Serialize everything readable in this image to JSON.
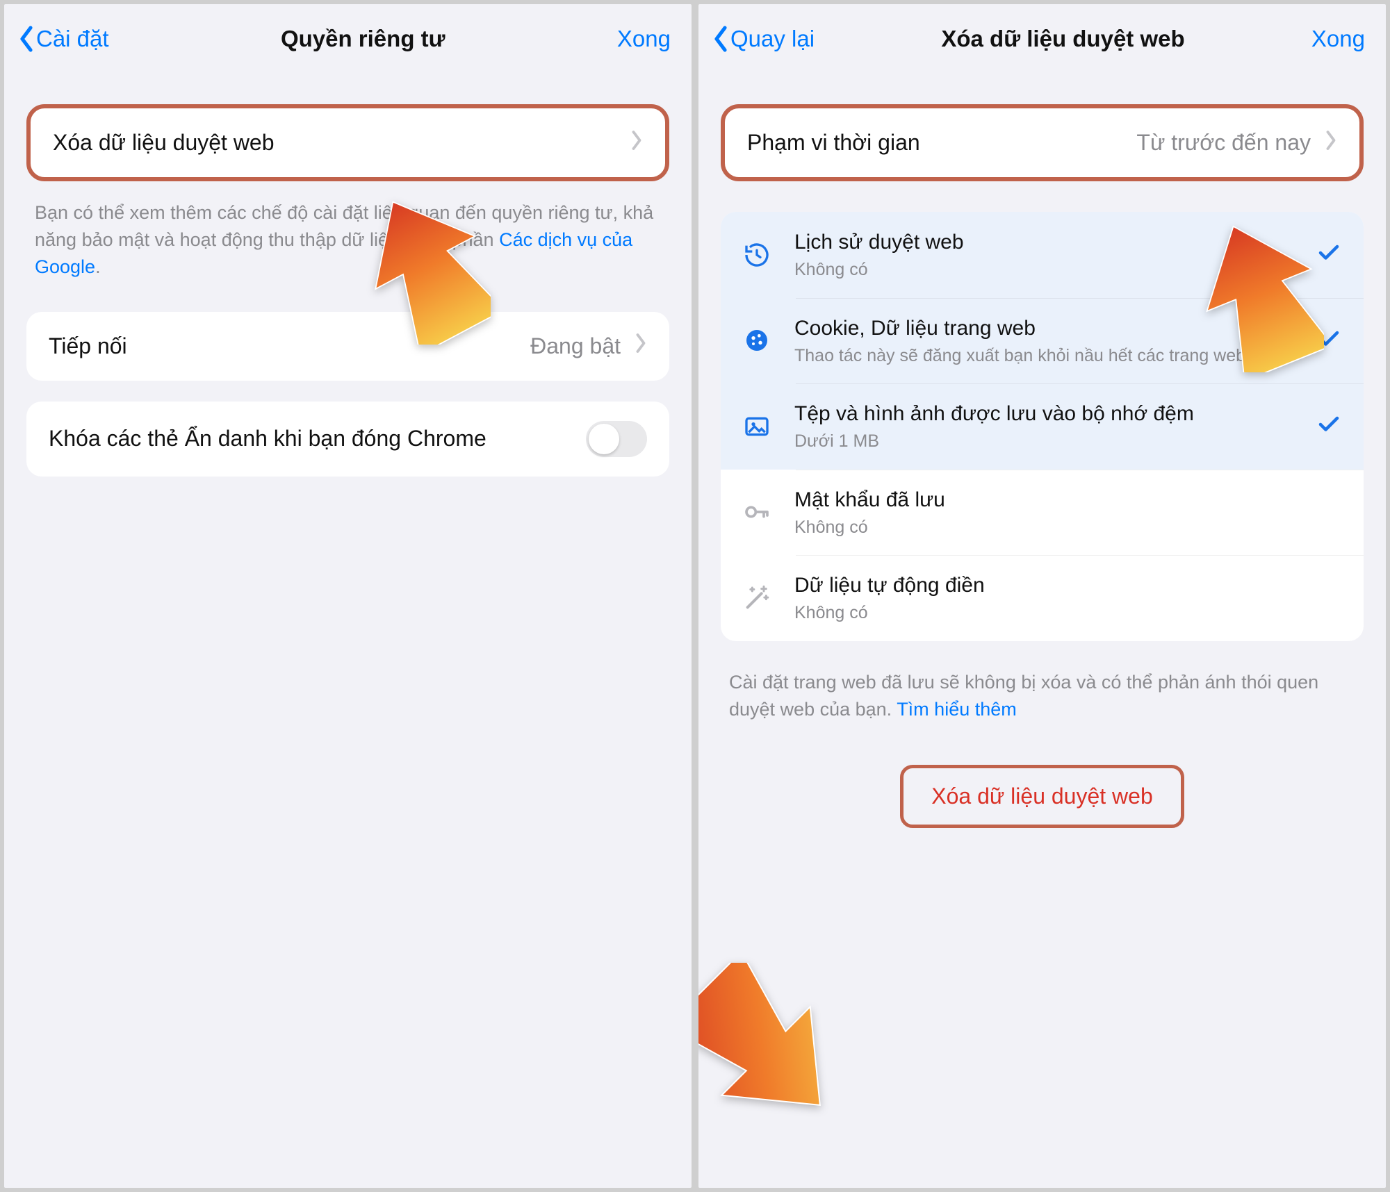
{
  "left": {
    "back_label": "Cài đặt",
    "title": "Quyền riêng tư",
    "done": "Xong",
    "clear_row": "Xóa dữ liệu duyệt web",
    "note_pre": "Bạn có thể xem thêm các chế độ cài đặt liên quan đến quyền riêng tư, khả năng bảo mật và hoạt động thu thập dữ liệu trong phần ",
    "note_link": "Các dịch vụ của Google",
    "note_post": ".",
    "preload_label": "Tiếp nối",
    "preload_value": "Đang bật",
    "lock_label": "Khóa các thẻ Ẩn danh khi bạn đóng Chrome"
  },
  "right": {
    "back_label": "Quay lại",
    "title": "Xóa dữ liệu duyệt web",
    "done": "Xong",
    "range_label": "Phạm vi thời gian",
    "range_value": "Từ trước đến nay",
    "options": [
      {
        "icon": "history-icon",
        "title": "Lịch sử duyệt web",
        "sub": "Không có",
        "selected": true
      },
      {
        "icon": "cookie-icon",
        "title": "Cookie, Dữ liệu trang web",
        "sub": "Thao tác này sẽ đăng xuất bạn khỏi nầu hết các trang web.",
        "selected": true
      },
      {
        "icon": "image-icon",
        "title": "Tệp và hình ảnh được lưu vào bộ nhớ đệm",
        "sub": "Dưới 1 MB",
        "selected": true
      },
      {
        "icon": "key-icon",
        "title": "Mật khẩu đã lưu",
        "sub": "Không có",
        "selected": false
      },
      {
        "icon": "wand-icon",
        "title": "Dữ liệu tự động điền",
        "sub": "Không có",
        "selected": false
      }
    ],
    "footer_pre": "Cài đặt trang web đã lưu sẽ không bị xóa và có thể phản ánh thói quen duyệt web của bạn. ",
    "footer_link": "Tìm hiểu thêm",
    "clear_button": "Xóa dữ liệu duyệt web"
  }
}
